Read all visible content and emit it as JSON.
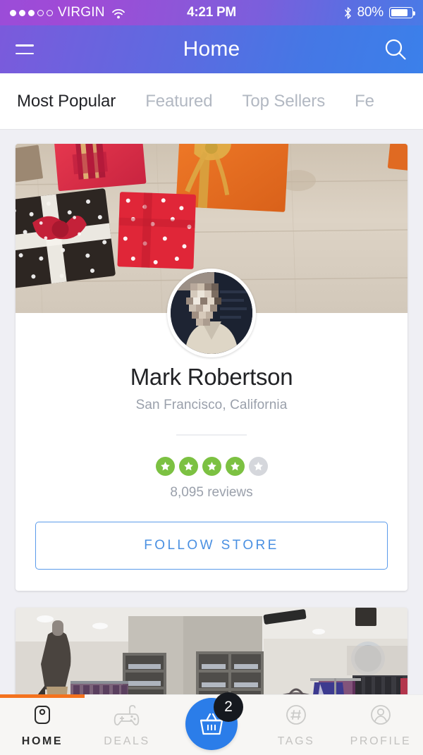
{
  "status_bar": {
    "carrier": "VIRGIN",
    "signal_dots_filled": 3,
    "signal_dots_total": 5,
    "wifi_icon": "wifi-icon",
    "time": "4:21 PM",
    "bluetooth_icon": "bluetooth-icon",
    "battery_percent": "80%",
    "battery_level": 80
  },
  "navbar": {
    "menu_icon": "hamburger-menu-icon",
    "title": "Home",
    "search_icon": "search-icon",
    "gradient_start": "#7b5adc",
    "gradient_end": "#3b80ea"
  },
  "tabs": [
    {
      "label": "Most Popular",
      "active": true
    },
    {
      "label": "Featured",
      "active": false
    },
    {
      "label": "Top Sellers",
      "active": false
    },
    {
      "label": "Fe",
      "active": false
    }
  ],
  "store_card": {
    "hero_image": "gift-boxes-on-wooden-table",
    "avatar_image": "pixelated-person-portrait",
    "name": "Mark Robertson",
    "location": "San Francisco, California",
    "rating": 4,
    "rating_max": 5,
    "reviews": "8,095 reviews",
    "follow_label": "FOLLOW STORE",
    "star_filled_color": "#7cc142",
    "star_empty_color": "#d5d7dc",
    "follow_color": "#4a90e2"
  },
  "second_card": {
    "image": "clothing-store-interior"
  },
  "progress": {
    "percent": 20,
    "color": "#f4721e"
  },
  "bottom_nav": {
    "items": [
      {
        "label": "HOME",
        "icon": "home-icon",
        "active": true
      },
      {
        "label": "DEALS",
        "icon": "gamepad-icon",
        "active": false
      },
      {
        "label": "TAGS",
        "icon": "hash-tag-icon",
        "active": false
      },
      {
        "label": "PROFILE",
        "icon": "person-profile-icon",
        "active": false
      }
    ],
    "cart": {
      "icon": "shopping-basket-icon",
      "badge": "2",
      "color": "#2b7de9",
      "badge_color": "#16191f"
    }
  }
}
